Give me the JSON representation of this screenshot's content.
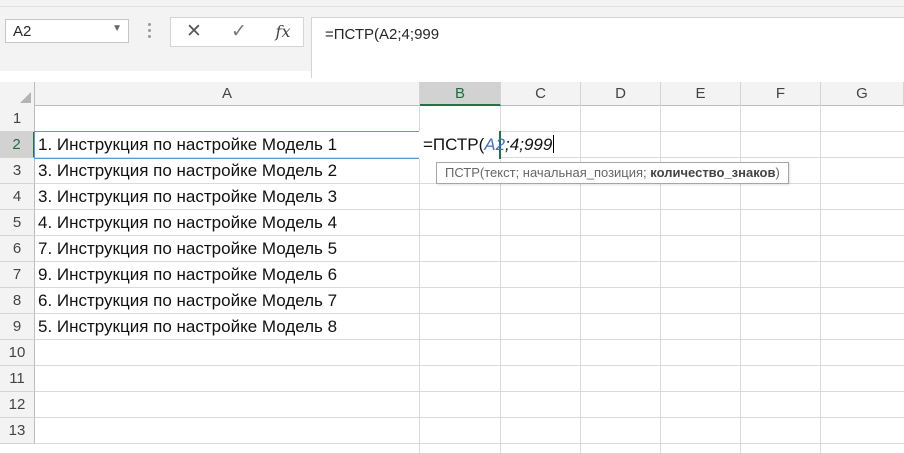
{
  "name_box": {
    "value": "A2"
  },
  "formula_bar": {
    "cancel_icon": "close-icon",
    "enter_icon": "check-icon",
    "function_label": "fx",
    "formula": "=ПСТР(A2;4;999"
  },
  "columns": [
    "A",
    "B",
    "C",
    "D",
    "E",
    "F",
    "G"
  ],
  "selected_column": "B",
  "rows": [
    "1",
    "2",
    "3",
    "4",
    "5",
    "6",
    "7",
    "8",
    "9",
    "10",
    "11",
    "12",
    "13"
  ],
  "selected_row": "2",
  "cells": {
    "A2": "1. Инструкция по настройке Модель 1",
    "A3": "3. Инструкция по настройке Модель 2",
    "A4": "3. Инструкция по настройке Модель 3",
    "A5": "4. Инструкция по настройке Модель 4",
    "A6": "7. Инструкция по настройке Модель 5",
    "A7": "9. Инструкция по настройке Модель 6",
    "A8": "6. Инструкция по настройке Модель 7",
    "A9": "5. Инструкция по настройке Модель 8"
  },
  "edit_cell": {
    "address": "B2",
    "prefix": "=ПСТР(",
    "ref": "A2",
    "rest": ";4;999"
  },
  "tooltip": {
    "func": "ПСТР(",
    "args_plain": "текст; начальная_позиция; ",
    "args_bold": "количество_знаков",
    "close": ")"
  }
}
